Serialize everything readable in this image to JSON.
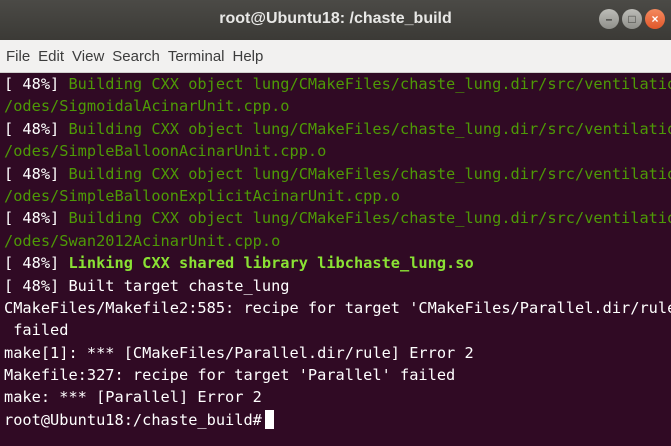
{
  "window": {
    "title": "root@Ubuntu18: /chaste_build"
  },
  "menu": [
    "File",
    "Edit",
    "View",
    "Search",
    "Terminal",
    "Help"
  ],
  "terminal": {
    "lines": [
      {
        "prefix": "[ 48%] ",
        "text": "Building CXX object lung/CMakeFiles/chaste_lung.dir/src/ventilation",
        "style": "green"
      },
      {
        "prefix": "",
        "text": "/odes/SigmoidalAcinarUnit.cpp.o",
        "style": "green"
      },
      {
        "prefix": "[ 48%] ",
        "text": "Building CXX object lung/CMakeFiles/chaste_lung.dir/src/ventilation",
        "style": "green"
      },
      {
        "prefix": "",
        "text": "/odes/SimpleBalloonAcinarUnit.cpp.o",
        "style": "green"
      },
      {
        "prefix": "[ 48%] ",
        "text": "Building CXX object lung/CMakeFiles/chaste_lung.dir/src/ventilation",
        "style": "green"
      },
      {
        "prefix": "",
        "text": "/odes/SimpleBalloonExplicitAcinarUnit.cpp.o",
        "style": "green"
      },
      {
        "prefix": "[ 48%] ",
        "text": "Building CXX object lung/CMakeFiles/chaste_lung.dir/src/ventilation",
        "style": "green"
      },
      {
        "prefix": "",
        "text": "/odes/Swan2012AcinarUnit.cpp.o",
        "style": "green"
      },
      {
        "prefix": "[ 48%] ",
        "text": "Linking CXX shared library libchaste_lung.so",
        "style": "bgreen"
      },
      {
        "prefix": "[ 48%] ",
        "text": "Built target chaste_lung",
        "style": "plain"
      },
      {
        "prefix": "",
        "text": "CMakeFiles/Makefile2:585: recipe for target 'CMakeFiles/Parallel.dir/rule'",
        "style": "plain"
      },
      {
        "prefix": "",
        "text": " failed",
        "style": "plain"
      },
      {
        "prefix": "",
        "text": "make[1]: *** [CMakeFiles/Parallel.dir/rule] Error 2",
        "style": "plain"
      },
      {
        "prefix": "",
        "text": "Makefile:327: recipe for target 'Parallel' failed",
        "style": "plain"
      },
      {
        "prefix": "",
        "text": "make: *** [Parallel] Error 2",
        "style": "plain"
      }
    ],
    "prompt": "root@Ubuntu18:/chaste_build# "
  },
  "colors": {
    "background": "#300a24",
    "text": "#ffffff",
    "green": "#4e9a06",
    "bright_green": "#8ae234",
    "close_button": "#e1572a"
  }
}
